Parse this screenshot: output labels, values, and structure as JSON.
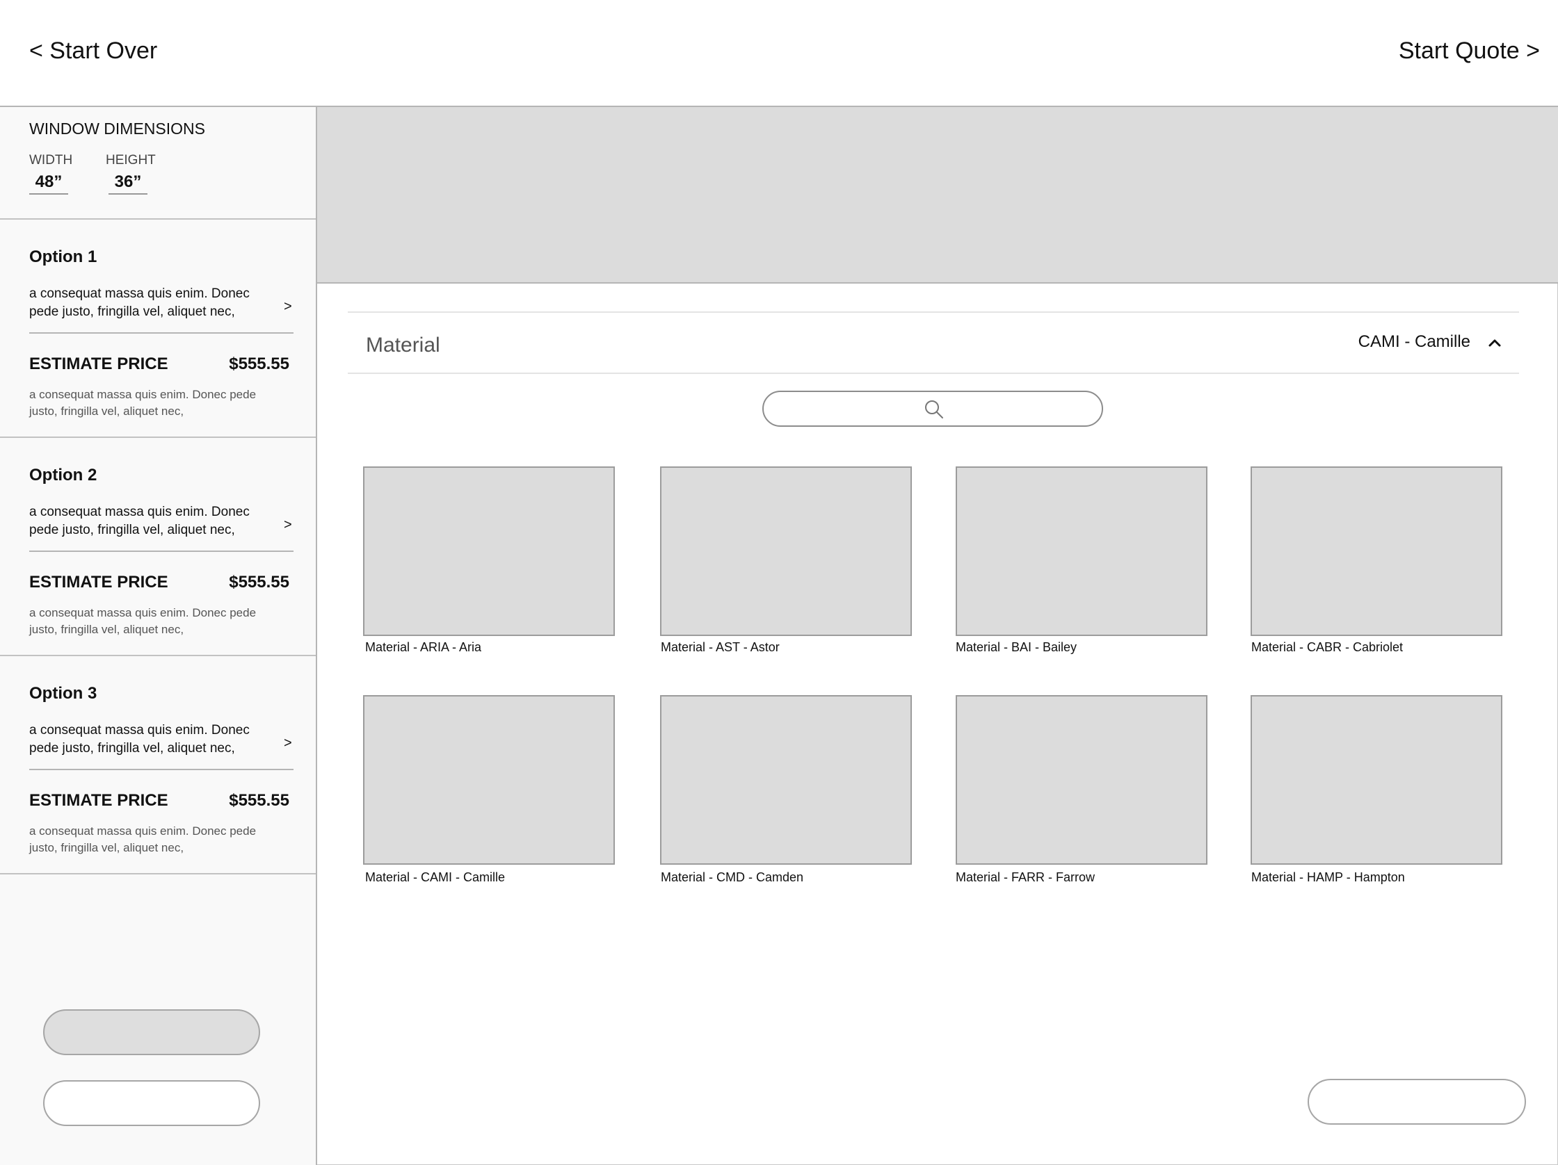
{
  "header": {
    "start_over": "< Start Over",
    "start_quote": "Start Quote >"
  },
  "dimensions": {
    "title": "WINDOW DIMENSIONS",
    "width_label": "WIDTH",
    "width_value": "48”",
    "height_label": "HEIGHT",
    "height_value": "36”"
  },
  "options": [
    {
      "title": "Option 1",
      "description": "a consequat massa quis enim. Donec pede justo, fringilla vel, aliquet nec,",
      "chevron": ">",
      "estimate_label": "ESTIMATE PRICE",
      "price": "$555.55",
      "note": "a consequat massa quis enim. Donec pede justo, fringilla vel, aliquet nec,"
    },
    {
      "title": "Option 2",
      "description": "a consequat massa quis enim. Donec pede justo, fringilla vel, aliquet nec,",
      "chevron": ">",
      "estimate_label": "ESTIMATE PRICE",
      "price": "$555.55",
      "note": "a consequat massa quis enim. Donec pede justo, fringilla vel, aliquet nec,"
    },
    {
      "title": "Option 3",
      "description": "a consequat massa quis enim. Donec pede justo, fringilla vel, aliquet nec,",
      "chevron": ">",
      "estimate_label": "ESTIMATE PRICE",
      "price": "$555.55",
      "note": "a consequat massa quis enim. Donec pede justo, fringilla vel, aliquet nec,"
    }
  ],
  "material": {
    "label": "Material",
    "selected": "CAMI - Camille",
    "chevron_icon": "chevron-up-icon",
    "search_icon": "search-icon",
    "items": [
      "Material - ARIA - Aria",
      "Material - AST - Astor",
      "Material - BAI - Bailey",
      "Material - CABR - Cabriolet",
      "Material - CAMI - Camille",
      "Material - CMD - Camden",
      "Material - FARR - Farrow",
      "Material - HAMP - Hampton"
    ]
  },
  "colors": {
    "placeholder_fill": "#dcdcdc",
    "border": "#b5b5b5",
    "sidebar_bg": "#f9f9f9"
  }
}
